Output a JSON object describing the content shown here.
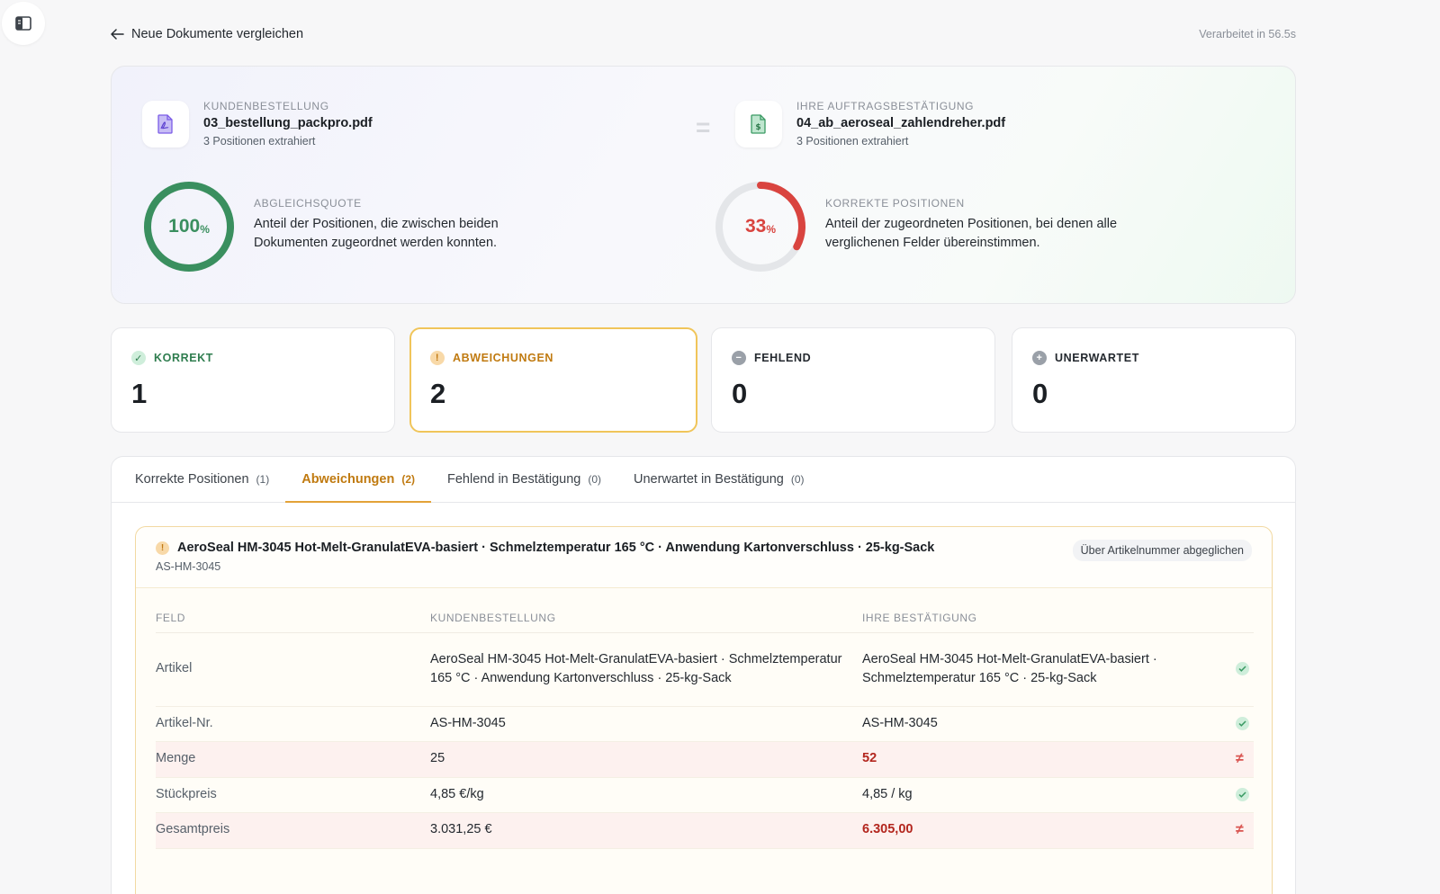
{
  "topbar": {
    "back_label": "Neue Dokumente vergleichen",
    "processed": "Verarbeitet in 56.5s"
  },
  "documents": {
    "left": {
      "kicker": "KUNDENBESTELLUNG",
      "name": "03_bestellung_packpro.pdf",
      "sub": "3 Positionen extrahiert",
      "icon": "pdf-file-icon"
    },
    "separator": "=",
    "right": {
      "kicker": "IHRE AUFTRAGSBESTÄTIGUNG",
      "name": "04_ab_aeroseal_zahlendreher.pdf",
      "sub": "3 Positionen extrahiert",
      "icon": "invoice-file-icon"
    }
  },
  "stats": {
    "match_rate": {
      "value": 100,
      "number": "100",
      "unit": "%",
      "kicker": "ABGLEICHSQUOTE",
      "desc": "Anteil der Positionen, die zwischen beiden Dokumenten zugeordnet werden konnten.",
      "color": "#3a8f5f"
    },
    "correct_rate": {
      "value": 33,
      "number": "33",
      "unit": "%",
      "kicker": "KORREKTE POSITIONEN",
      "desc": "Anteil der zugeordneten Positionen, bei denen alle verglichenen Felder übereinstimmen.",
      "color": "#d9443f"
    }
  },
  "cards": [
    {
      "label": "KORREKT",
      "value": "1",
      "color": "#2f7d4f",
      "icon": "check-circle-icon",
      "glyph": "✓"
    },
    {
      "label": "ABWEICHUNGEN",
      "value": "2",
      "color": "#c07a10",
      "icon": "warning-circle-icon",
      "glyph": "!"
    },
    {
      "label": "FEHLEND",
      "value": "0",
      "color": "#24292f",
      "icon": "minus-circle-icon",
      "glyph": "−"
    },
    {
      "label": "UNERWARTET",
      "value": "0",
      "color": "#24292f",
      "icon": "plus-circle-icon",
      "glyph": "+"
    }
  ],
  "tabs": [
    {
      "label": "Korrekte Positionen",
      "count": "(1)"
    },
    {
      "label": "Abweichungen",
      "count": "(2)"
    },
    {
      "label": "Fehlend in Bestätigung",
      "count": "(0)"
    },
    {
      "label": "Unerwartet in Bestätigung",
      "count": "(0)"
    }
  ],
  "item": {
    "title": "AeroSeal HM-3045 Hot-Melt-GranulatEVA-basiert · Schmelztemperatur 165 °C · Anwendung Kartonverschluss · 25-kg-Sack",
    "sku": "AS-HM-3045",
    "match_badge": "Über Artikelnummer abgeglichen",
    "columns": [
      "FELD",
      "KUNDENBESTELLUNG",
      "IHRE BESTÄTIGUNG"
    ],
    "rows": [
      {
        "field": "Artikel",
        "order": "AeroSeal HM-3045 Hot-Melt-GranulatEVA-basiert · Schmelztemperatur 165 °C · Anwendung Kartonverschluss · 25-kg-Sack",
        "confirmation": "AeroSeal HM-3045 Hot-Melt-GranulatEVA-basiert · Schmelztemperatur 165 °C · 25-kg-Sack",
        "status": "ok"
      },
      {
        "field": "Artikel-Nr.",
        "order": "AS-HM-3045",
        "confirmation": "AS-HM-3045",
        "status": "ok"
      },
      {
        "field": "Menge",
        "order": "25",
        "confirmation": "52",
        "status": "diff"
      },
      {
        "field": "Stückpreis",
        "order": "4,85 €/kg",
        "confirmation": "4,85 / kg",
        "status": "ok"
      },
      {
        "field": "Gesamtpreis",
        "order": "3.031,25 €",
        "confirmation": "6.305,00",
        "status": "diff"
      }
    ]
  }
}
